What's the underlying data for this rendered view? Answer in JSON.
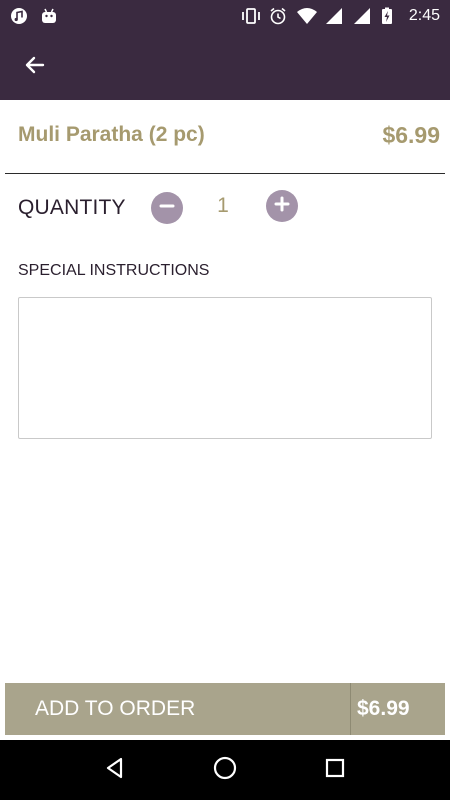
{
  "status_bar": {
    "time": "2:45",
    "icons_left": [
      "music-icon",
      "android-icon"
    ],
    "icons_right": [
      "vibrate-icon",
      "alarm-icon",
      "wifi-icon",
      "signal-icon",
      "signal-icon",
      "battery-charging-icon"
    ]
  },
  "app_bar": {
    "back_icon": "arrow-left-icon"
  },
  "item": {
    "name": "Muli Paratha (2 pc)",
    "price": "$6.99"
  },
  "quantity": {
    "label": "QUANTITY",
    "value": "1",
    "minus_icon": "minus-circle-icon",
    "plus_icon": "plus-circle-icon"
  },
  "special_instructions": {
    "label": "SPECIAL INSTRUCTIONS",
    "value": "",
    "placeholder": ""
  },
  "order_bar": {
    "label": "ADD TO ORDER",
    "price": "$6.99"
  },
  "nav_bar": {
    "icons": [
      "back-triangle-icon",
      "home-circle-icon",
      "recents-square-icon"
    ]
  },
  "colors": {
    "app_bar": "#3a2a40",
    "accent_text": "#a69a6f",
    "qty_button": "#a393a9",
    "order_bar": "#a9a48c"
  }
}
